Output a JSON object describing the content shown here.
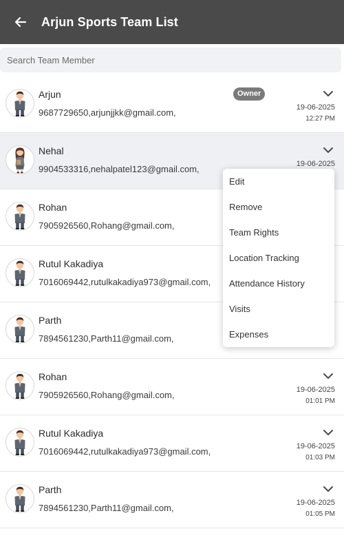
{
  "app": {
    "title": "Arjun Sports Team List",
    "back_icon": "arrow-left-icon"
  },
  "search": {
    "placeholder": "Search Team Member",
    "value": ""
  },
  "colors": {
    "appbar": "#4a4a4a",
    "selected_row": "#eef0f4",
    "badge": "#7a7a7a"
  },
  "members": [
    {
      "name": "Arjun",
      "contact": "9687729650,arjunjjkk@gmail.com,",
      "badge": "Owner",
      "date": "19-06-2025",
      "time": "12:27 PM",
      "avatar": "male-avatar"
    },
    {
      "name": "Nehal",
      "contact": "9904533316,nehalpatel123@gmail.com,",
      "badge": "",
      "date": "19-06-2025",
      "time": "",
      "avatar": "female-avatar"
    },
    {
      "name": "Rohan",
      "contact": "7905926560,Rohang@gmail.com,",
      "badge": "",
      "date": "",
      "time": "",
      "avatar": "male-avatar"
    },
    {
      "name": "Rutul Kakadiya",
      "contact": "7016069442,rutulkakadiya973@gmail.com,",
      "badge": "",
      "date": "",
      "time": "",
      "avatar": "male-avatar"
    },
    {
      "name": "Parth",
      "contact": "7894561230,Parth11@gmail.com,",
      "badge": "",
      "date": "",
      "time": "",
      "avatar": "male-avatar"
    },
    {
      "name": "Rohan",
      "contact": "7905926560,Rohang@gmail.com,",
      "badge": "",
      "date": "19-06-2025",
      "time": "01:01 PM",
      "avatar": "male-avatar"
    },
    {
      "name": "Rutul Kakadiya",
      "contact": "7016069442,rutulkakadiya973@gmail.com,",
      "badge": "",
      "date": "19-06-2025",
      "time": "01:03 PM",
      "avatar": "male-avatar"
    },
    {
      "name": "Parth",
      "contact": "7894561230,Parth11@gmail.com,",
      "badge": "",
      "date": "19-06-2025",
      "time": "01:05 PM",
      "avatar": "male-avatar"
    }
  ],
  "menu": {
    "items": [
      "Edit",
      "Remove",
      "Team Rights",
      "Location Tracking",
      "Attendance History",
      "Visits",
      "Expenses"
    ]
  }
}
